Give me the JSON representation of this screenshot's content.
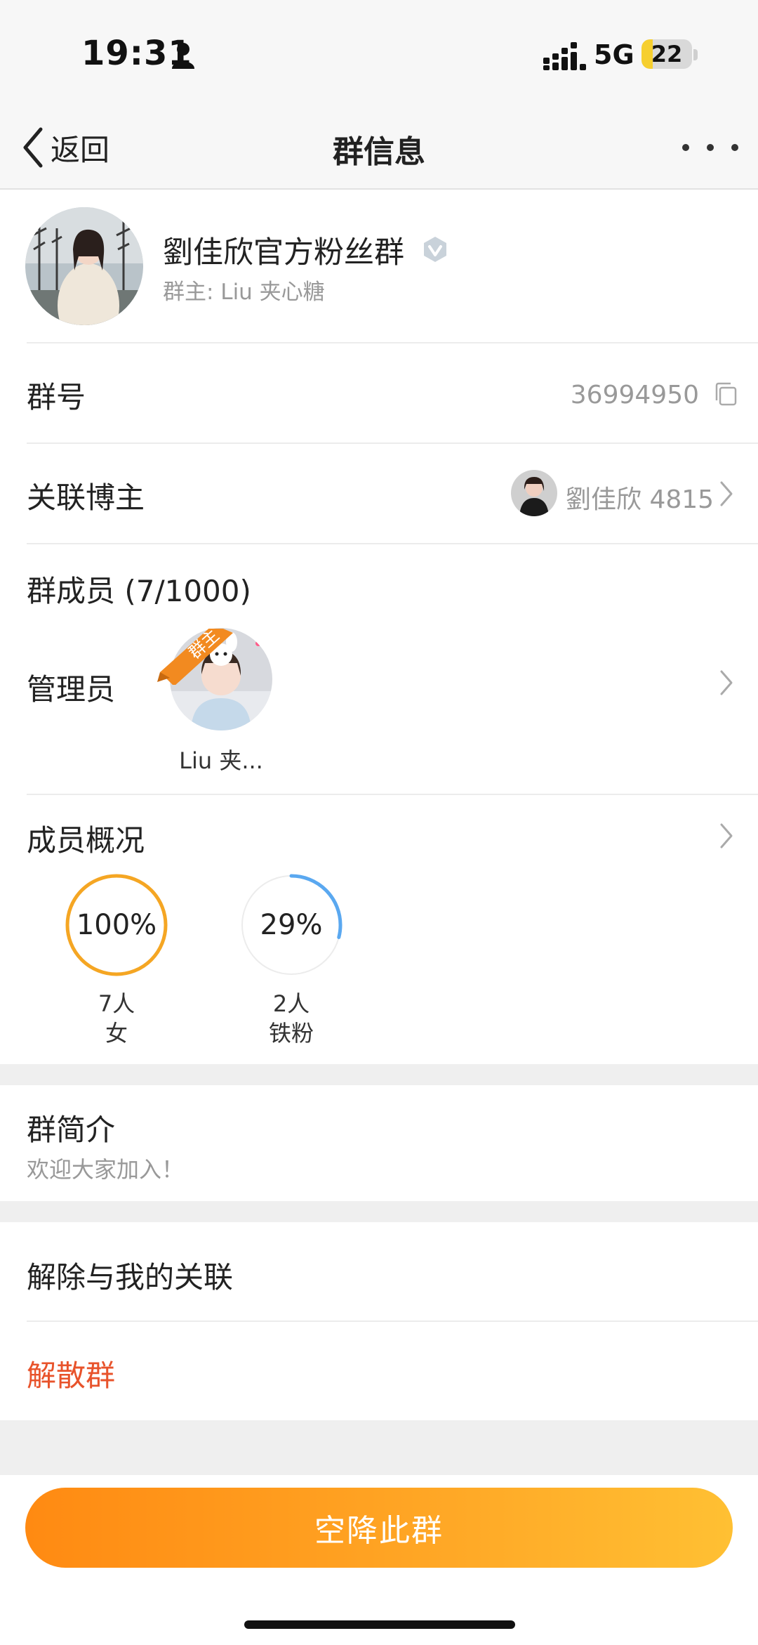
{
  "status_bar": {
    "time": "19:31",
    "network": "5G",
    "battery_level": "22",
    "battery_fraction": 0.22,
    "icons": [
      "person-icon",
      "signal-icon",
      "battery-icon"
    ]
  },
  "nav": {
    "back_label": "返回",
    "title": "群信息",
    "icons": [
      "chevron-left-icon",
      "more-icon"
    ]
  },
  "group": {
    "name": "劉佳欣官方粉丝群",
    "owner": "群主: Liu 夹心糖"
  },
  "group_id": {
    "label": "群号",
    "value": "36994950"
  },
  "blogger": {
    "label": "关联博主",
    "name": "劉佳欣 4815"
  },
  "members": {
    "title": "群成员 (7/1000)",
    "admin_label": "管理员",
    "admin_name": "Liu 夹...",
    "owner_tag": "群主"
  },
  "overview": {
    "title": "成员概况",
    "stats": [
      {
        "percent_text": "100%",
        "fraction": 1.0,
        "count": "7人",
        "category": "女",
        "color": "#f5a623"
      },
      {
        "percent_text": "29%",
        "fraction": 0.29,
        "count": "2人",
        "category": "铁粉",
        "color": "#5aa8f0"
      }
    ]
  },
  "intro": {
    "label": "群简介",
    "text": "欢迎大家加入！"
  },
  "actions": {
    "unlink": "解除与我的关联",
    "disband": "解散群",
    "airdrop": "空降此群"
  },
  "colors": {
    "accent_orange": "#ff8a12",
    "danger_red": "#e8532b",
    "ring_orange": "#f5a623",
    "ring_blue": "#5aa8f0"
  }
}
